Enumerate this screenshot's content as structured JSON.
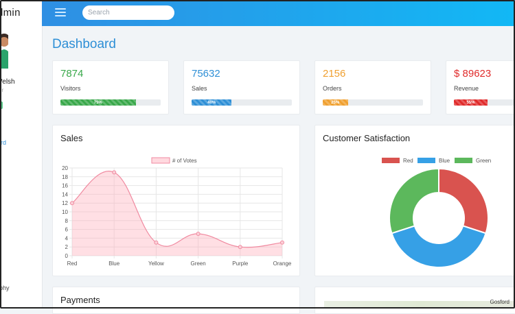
{
  "brand": {
    "name": "dmin"
  },
  "user": {
    "name": "Welsh",
    "role": "er"
  },
  "nav": {
    "active_label": "ard",
    "bottom_label": "ophy"
  },
  "header": {
    "search_placeholder": "Search"
  },
  "page": {
    "title": "Dashboard"
  },
  "stats": [
    {
      "value": "7874",
      "label": "Visitors",
      "progress": 75,
      "progress_label": "75%",
      "color": "#39a84a"
    },
    {
      "value": "75632",
      "label": "Sales",
      "progress": 40,
      "progress_label": "40%",
      "color": "#2e8fd6"
    },
    {
      "value": "2156",
      "label": "Orders",
      "progress": 25,
      "progress_label": "25%",
      "color": "#f0a030"
    },
    {
      "value": "$ 89623",
      "label": "Revenue",
      "progress": 55,
      "progress_label": "55%",
      "color": "#e02b2b"
    }
  ],
  "sales_card": {
    "title": "Sales"
  },
  "satisfaction_card": {
    "title": "Customer Satisfaction"
  },
  "payments_card": {
    "title": "Payments"
  },
  "map_card": {
    "place_label": "Gosford"
  },
  "chart_data": [
    {
      "type": "area",
      "title": "Sales",
      "categories": [
        "Red",
        "Blue",
        "Yellow",
        "Green",
        "Purple",
        "Orange"
      ],
      "series": [
        {
          "name": "# of Votes",
          "values": [
            12,
            19,
            3,
            5,
            2,
            3
          ],
          "color": "#f08aa0"
        }
      ],
      "ylim": [
        0,
        20
      ],
      "yticks": [
        0,
        2,
        4,
        6,
        8,
        10,
        12,
        14,
        16,
        18,
        20
      ],
      "grid": true,
      "legend": "top"
    },
    {
      "type": "pie",
      "title": "Customer Satisfaction",
      "donut": true,
      "labels": [
        "Red",
        "Blue",
        "Green"
      ],
      "values": [
        30,
        40,
        30
      ],
      "colors": [
        "#d9534f",
        "#36a0e6",
        "#5cb85c"
      ],
      "legend": "top"
    }
  ]
}
